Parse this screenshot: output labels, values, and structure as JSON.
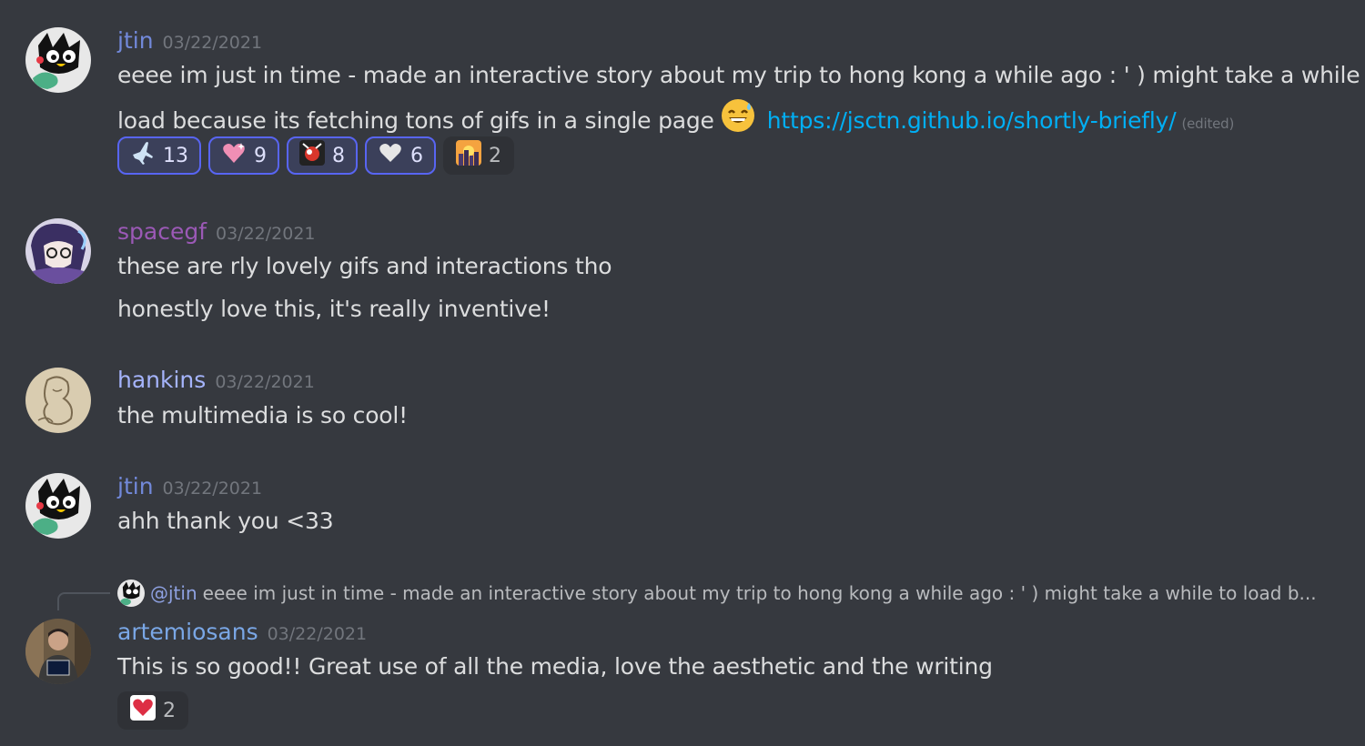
{
  "messages": [
    {
      "username": "jtin",
      "username_color": "#7289da",
      "timestamp": "03/22/2021",
      "lines": [
        "eeee im just in time - made an interactive story about my trip to hong kong a while ago : ' ) might take a while to",
        "load because its fetching tons of gifs in a single page"
      ],
      "link": "https://jsctn.github.io/shortly-briefly/",
      "edited": "(edited)",
      "reactions": [
        {
          "icon": "airplane-emoji",
          "count": "13",
          "me": true
        },
        {
          "icon": "sparkling-heart-emoji",
          "count": "9",
          "me": true
        },
        {
          "icon": "custom-emoji",
          "count": "8",
          "me": true
        },
        {
          "icon": "white-heart-emoji",
          "count": "6",
          "me": true
        },
        {
          "icon": "sunrise-city-emoji",
          "count": "2",
          "me": false
        }
      ]
    },
    {
      "username": "spacegf",
      "username_color": "#9b59b6",
      "timestamp": "03/22/2021",
      "lines": [
        "these are rly lovely gifs and interactions tho",
        "honestly love this, it's really inventive!"
      ]
    },
    {
      "username": "hankins",
      "username_color": "#a5b4fc",
      "timestamp": "03/22/2021",
      "lines": [
        "the multimedia is so cool!"
      ]
    },
    {
      "username": "jtin",
      "username_color": "#7289da",
      "timestamp": "03/22/2021",
      "lines": [
        "ahh thank you <33"
      ]
    },
    {
      "reply": {
        "mention": "@jtin",
        "text": "eeee im just in time - made an interactive story about my trip to hong kong a while ago : ' ) might take a while to load b..."
      },
      "username": "artemiosans",
      "username_color": "#7aa7e6",
      "timestamp": "03/22/2021",
      "lines": [
        "This is so good!! Great use of all the media, love the aesthetic and the writing"
      ],
      "reactions": [
        {
          "icon": "red-heart-emoji",
          "count": "2",
          "me": false
        }
      ]
    }
  ]
}
